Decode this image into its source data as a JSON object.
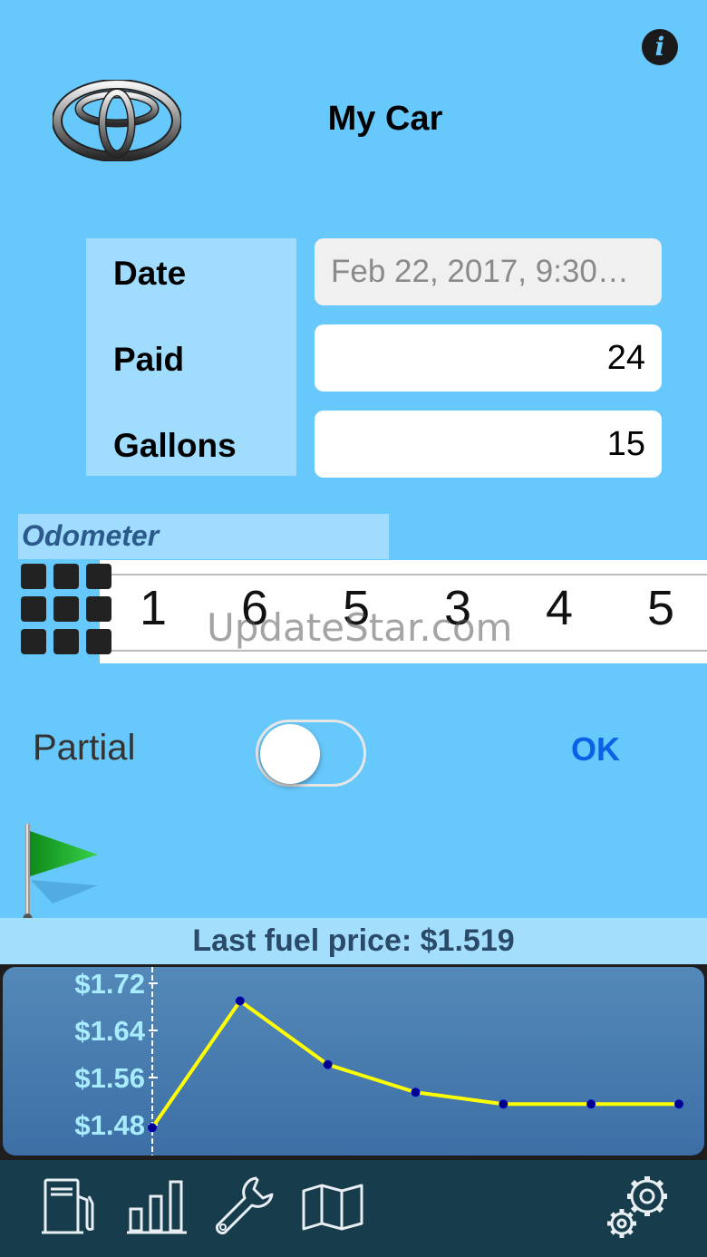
{
  "header": {
    "title": "My Car",
    "info_icon": "info-icon",
    "info_glyph": "i",
    "logo_icon": "toyota-logo"
  },
  "form": {
    "date_label": "Date",
    "paid_label": "Paid",
    "gallons_label": "Gallons",
    "date_value": "Feb 22, 2017, 9:30…",
    "paid_value": "24",
    "gallons_value": "15"
  },
  "odometer": {
    "label": "Odometer",
    "keypad_icon": "keypad-icon",
    "digits": [
      "1",
      "6",
      "5",
      "3",
      "4",
      "5"
    ]
  },
  "partial": {
    "label": "Partial",
    "toggle_on": false,
    "ok_label": "OK"
  },
  "flag_icon": "green-flag-icon",
  "watermark": "UpdateStar.com",
  "last_price": "Last fuel price: $1.519",
  "chart_data": {
    "type": "line",
    "title": "",
    "xlabel": "",
    "ylabel": "",
    "y_tick_labels": [
      "$1.72",
      "$1.64",
      "$1.56",
      "$1.48"
    ],
    "y_ticks": [
      1.72,
      1.64,
      1.56,
      1.48
    ],
    "ylim": [
      1.45,
      1.74
    ],
    "x": [
      1,
      2,
      3,
      4,
      5,
      6,
      7
    ],
    "series": [
      {
        "values": [
          1.475,
          1.69,
          1.582,
          1.535,
          1.515,
          1.515,
          1.515
        ]
      }
    ],
    "grid": false,
    "line_color": "#ffff00",
    "point_color": "#00008b"
  },
  "tabbar": {
    "items": [
      "fuel-pump-icon",
      "bar-chart-icon",
      "wrench-icon",
      "map-icon",
      "settings-gears-icon"
    ]
  },
  "colors": {
    "background": "#67c8fb",
    "accent": "#0a62e6",
    "tabbar": "#173d4c"
  }
}
